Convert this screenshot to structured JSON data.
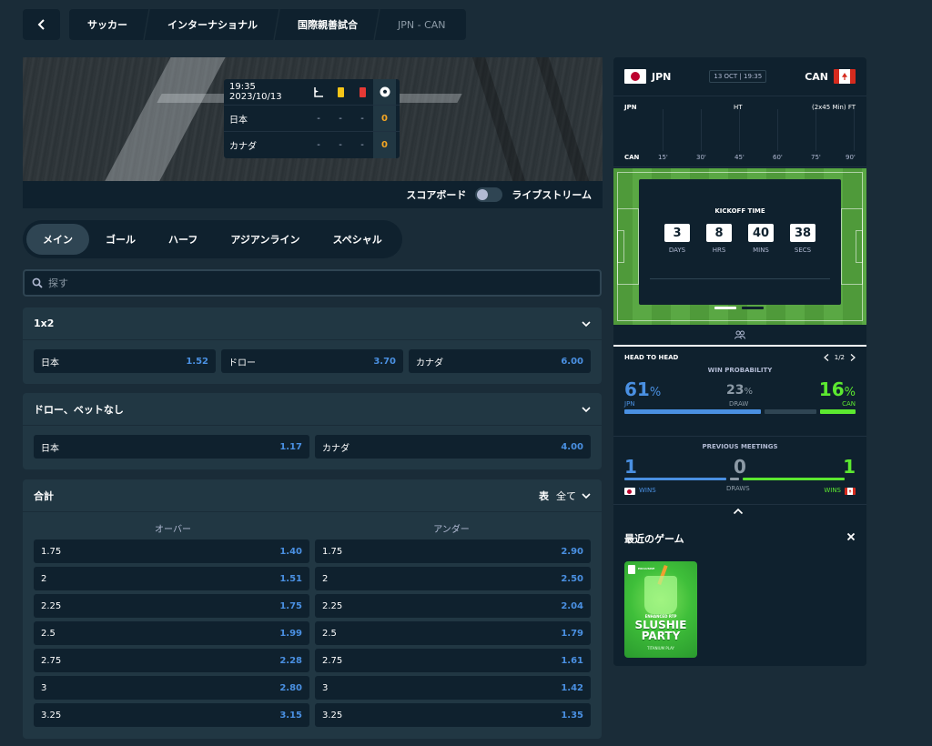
{
  "breadcrumb": [
    "サッカー",
    "インターナショナル",
    "国際親善試合",
    "JPN - CAN"
  ],
  "scoreboard": {
    "time": "19:35 2023/10/13",
    "teams": [
      {
        "name": "日本",
        "corners": "-",
        "yellow": "-",
        "red": "-",
        "goals": "0"
      },
      {
        "name": "カナダ",
        "corners": "-",
        "yellow": "-",
        "red": "-",
        "goals": "0"
      }
    ],
    "toggle_left": "スコアボード",
    "toggle_right": "ライブストリーム"
  },
  "tabs": [
    "メイン",
    "ゴール",
    "ハーフ",
    "アジアンライン",
    "スペシャル"
  ],
  "search": {
    "placeholder": "探す"
  },
  "markets": {
    "m1x2": {
      "title": "1x2",
      "odds": [
        {
          "label": "日本",
          "price": "1.52"
        },
        {
          "label": "ドロー",
          "price": "3.70"
        },
        {
          "label": "カナダ",
          "price": "6.00"
        }
      ]
    },
    "dnb": {
      "title": "ドロー、ベットなし",
      "odds": [
        {
          "label": "日本",
          "price": "1.17"
        },
        {
          "label": "カナダ",
          "price": "4.00"
        }
      ]
    },
    "totals": {
      "title": "合計",
      "view_label": "表",
      "filter_label": "全て",
      "over_label": "オーバー",
      "under_label": "アンダー",
      "rows": [
        {
          "line": "1.75",
          "over": "1.40",
          "under": "2.90"
        },
        {
          "line": "2",
          "over": "1.51",
          "under": "2.50"
        },
        {
          "line": "2.25",
          "over": "1.75",
          "under": "2.04"
        },
        {
          "line": "2.5",
          "over": "1.99",
          "under": "1.79"
        },
        {
          "line": "2.75",
          "over": "2.28",
          "under": "1.61"
        },
        {
          "line": "3",
          "over": "2.80",
          "under": "1.42"
        },
        {
          "line": "3.25",
          "over": "3.15",
          "under": "1.35"
        }
      ]
    }
  },
  "match": {
    "home": "JPN",
    "away": "CAN",
    "date": "13 OCT | 19:35",
    "timeline": {
      "top_left": "JPN",
      "top_mid": "HT",
      "top_right": "(2x45 Min) FT",
      "bottom_left": "CAN",
      "ticks": [
        "15'",
        "30'",
        "45'",
        "60'",
        "75'",
        "90'"
      ]
    },
    "kickoff": {
      "title": "KICKOFF TIME",
      "units": [
        {
          "value": "3",
          "label": "DAYS"
        },
        {
          "value": "8",
          "label": "HRS"
        },
        {
          "value": "40",
          "label": "MINS"
        },
        {
          "value": "38",
          "label": "SECS"
        }
      ]
    }
  },
  "head_to_head": {
    "title": "HEAD TO HEAD",
    "page": "1/2",
    "win_probability": {
      "title": "WIN PROBABILITY",
      "home_pct": "61",
      "draw_pct": "23",
      "away_pct": "16",
      "pct_sign": "%",
      "home_label": "JPN",
      "draw_label": "DRAW",
      "away_label": "CAN",
      "home_fraction": 0.61,
      "draw_fraction": 0.23,
      "away_fraction": 0.16
    },
    "previous_meetings": {
      "title": "PREVIOUS MEETINGS",
      "home_wins": "1",
      "draws": "0",
      "away_wins": "1",
      "wins_label": "WINS",
      "draws_label": "DRAWS"
    }
  },
  "recent_games": {
    "title": "最近のゲーム",
    "game": {
      "badge": "EXCLUSIVE",
      "subtitle": "ENHANCED RTP",
      "name_line1": "SLUSHIE",
      "name_line2": "PARTY",
      "provider": "TITANIUM PLAY"
    }
  },
  "colors": {
    "home_blue": "#4a90e2",
    "away_green": "#5ce830",
    "gold": "#f5a623",
    "bg": "#1a2c38",
    "panel": "#0f212e"
  }
}
